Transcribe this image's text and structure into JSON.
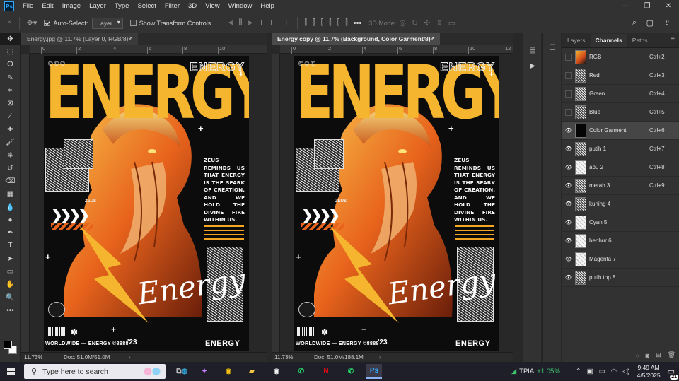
{
  "app": {
    "logo": "Ps"
  },
  "menu": [
    "File",
    "Edit",
    "Image",
    "Layer",
    "Type",
    "Select",
    "Filter",
    "3D",
    "View",
    "Window",
    "Help"
  ],
  "window_controls": {
    "minimize": "—",
    "maximize": "❐",
    "close": "✕"
  },
  "options": {
    "auto_select_label": "Auto-Select:",
    "auto_select_checked": true,
    "target_value": "Layer",
    "show_transform_label": "Show Transform Controls",
    "show_transform_checked": false,
    "mode_3d_label": "3D Mode:",
    "more": "•••"
  },
  "tools": [
    "move-tool",
    "marquee-tool",
    "lasso-tool",
    "quick-select-tool",
    "crop-tool",
    "frame-tool",
    "eyedropper-tool",
    "healing-tool",
    "brush-tool",
    "clone-stamp-tool",
    "history-brush-tool",
    "eraser-tool",
    "gradient-tool",
    "blur-tool",
    "dodge-tool",
    "pen-tool",
    "type-tool",
    "path-select-tool",
    "rectangle-tool",
    "hand-tool",
    "zoom-tool",
    "more-tools"
  ],
  "tool_glyphs": [
    "✥",
    "⬚",
    "ⵔ",
    "✎",
    "⌗",
    "⊠",
    "⁄",
    "✚",
    "🖌",
    "⎈",
    "↺",
    "⌫",
    "▦",
    "💧",
    "●",
    "✒",
    "T",
    "➤",
    "▭",
    "✋",
    "🔍",
    "•••"
  ],
  "doc1": {
    "tab_title": "Energy.jpg @ 11.7% (Layer 0, RGB/8) *",
    "close": "×",
    "zoom": "11.73%",
    "doc_info": "Doc: 51.0M/51.0M",
    "ruler": [
      "0",
      "2",
      "4",
      "6",
      "8",
      "10"
    ]
  },
  "doc2": {
    "tab_title": "Energy copy @ 11.7% (Background, Color Garment/8) *",
    "close": "×",
    "zoom": "11.73%",
    "doc_info": "Doc: 51.0M/188.1M",
    "ruler": [
      "0",
      "2",
      "4",
      "6",
      "8",
      "10",
      "12"
    ]
  },
  "poster": {
    "headline": "ENERGY",
    "outline_title": "ENERGY",
    "symbols": "©©©",
    "quote": "ZEUS REMINDS US THAT ENERGY IS THE SPARK OF CREATION, AND WE HOLD THE DIVINE FIRE WITHIN US.",
    "zeus_label": "ZEUS",
    "chevrons": "❯❯❯❯",
    "script": "Energy",
    "worldwide": "WORLDWIDE — ENERGY ©8888",
    "year": "'23",
    "footer_title": "ENERGY",
    "colors": {
      "yellow": "#f5b52e",
      "orange": "#e8631c"
    }
  },
  "panel": {
    "tabs": [
      "Layers",
      "Channels",
      "Paths"
    ],
    "active_tab": "Channels",
    "menu": "≡",
    "channels": [
      {
        "name": "RGB",
        "key": "Ctrl+2",
        "visible": false,
        "thumb": "rgb"
      },
      {
        "name": "Red",
        "key": "Ctrl+3",
        "visible": false,
        "thumb": "gray"
      },
      {
        "name": "Green",
        "key": "Ctrl+4",
        "visible": false,
        "thumb": "gray"
      },
      {
        "name": "Blue",
        "key": "Ctrl+5",
        "visible": false,
        "thumb": "gray"
      },
      {
        "name": "Color Garment",
        "key": "Ctrl+6",
        "visible": true,
        "thumb": "black",
        "selected": true
      },
      {
        "name": "putih 1",
        "key": "Ctrl+7",
        "visible": true,
        "thumb": "gray"
      },
      {
        "name": "abu 2",
        "key": "Ctrl+8",
        "visible": true,
        "thumb": "light"
      },
      {
        "name": "merah 3",
        "key": "Ctrl+9",
        "visible": true,
        "thumb": "gray"
      },
      {
        "name": "kuning 4",
        "key": "",
        "visible": true,
        "thumb": "gray"
      },
      {
        "name": "Cyan 5",
        "key": "",
        "visible": true,
        "thumb": "light"
      },
      {
        "name": "benhur 6",
        "key": "",
        "visible": true,
        "thumb": "light"
      },
      {
        "name": "Magenta 7",
        "key": "",
        "visible": true,
        "thumb": "light"
      },
      {
        "name": "putih top 8",
        "key": "",
        "visible": true,
        "thumb": "gray"
      }
    ]
  },
  "taskbar": {
    "search_placeholder": "Type here to search",
    "stock_name": "TPIA",
    "stock_change": "+1.05%",
    "time": "9:49 AM",
    "date": "4/5/2025",
    "notifications": "21"
  }
}
